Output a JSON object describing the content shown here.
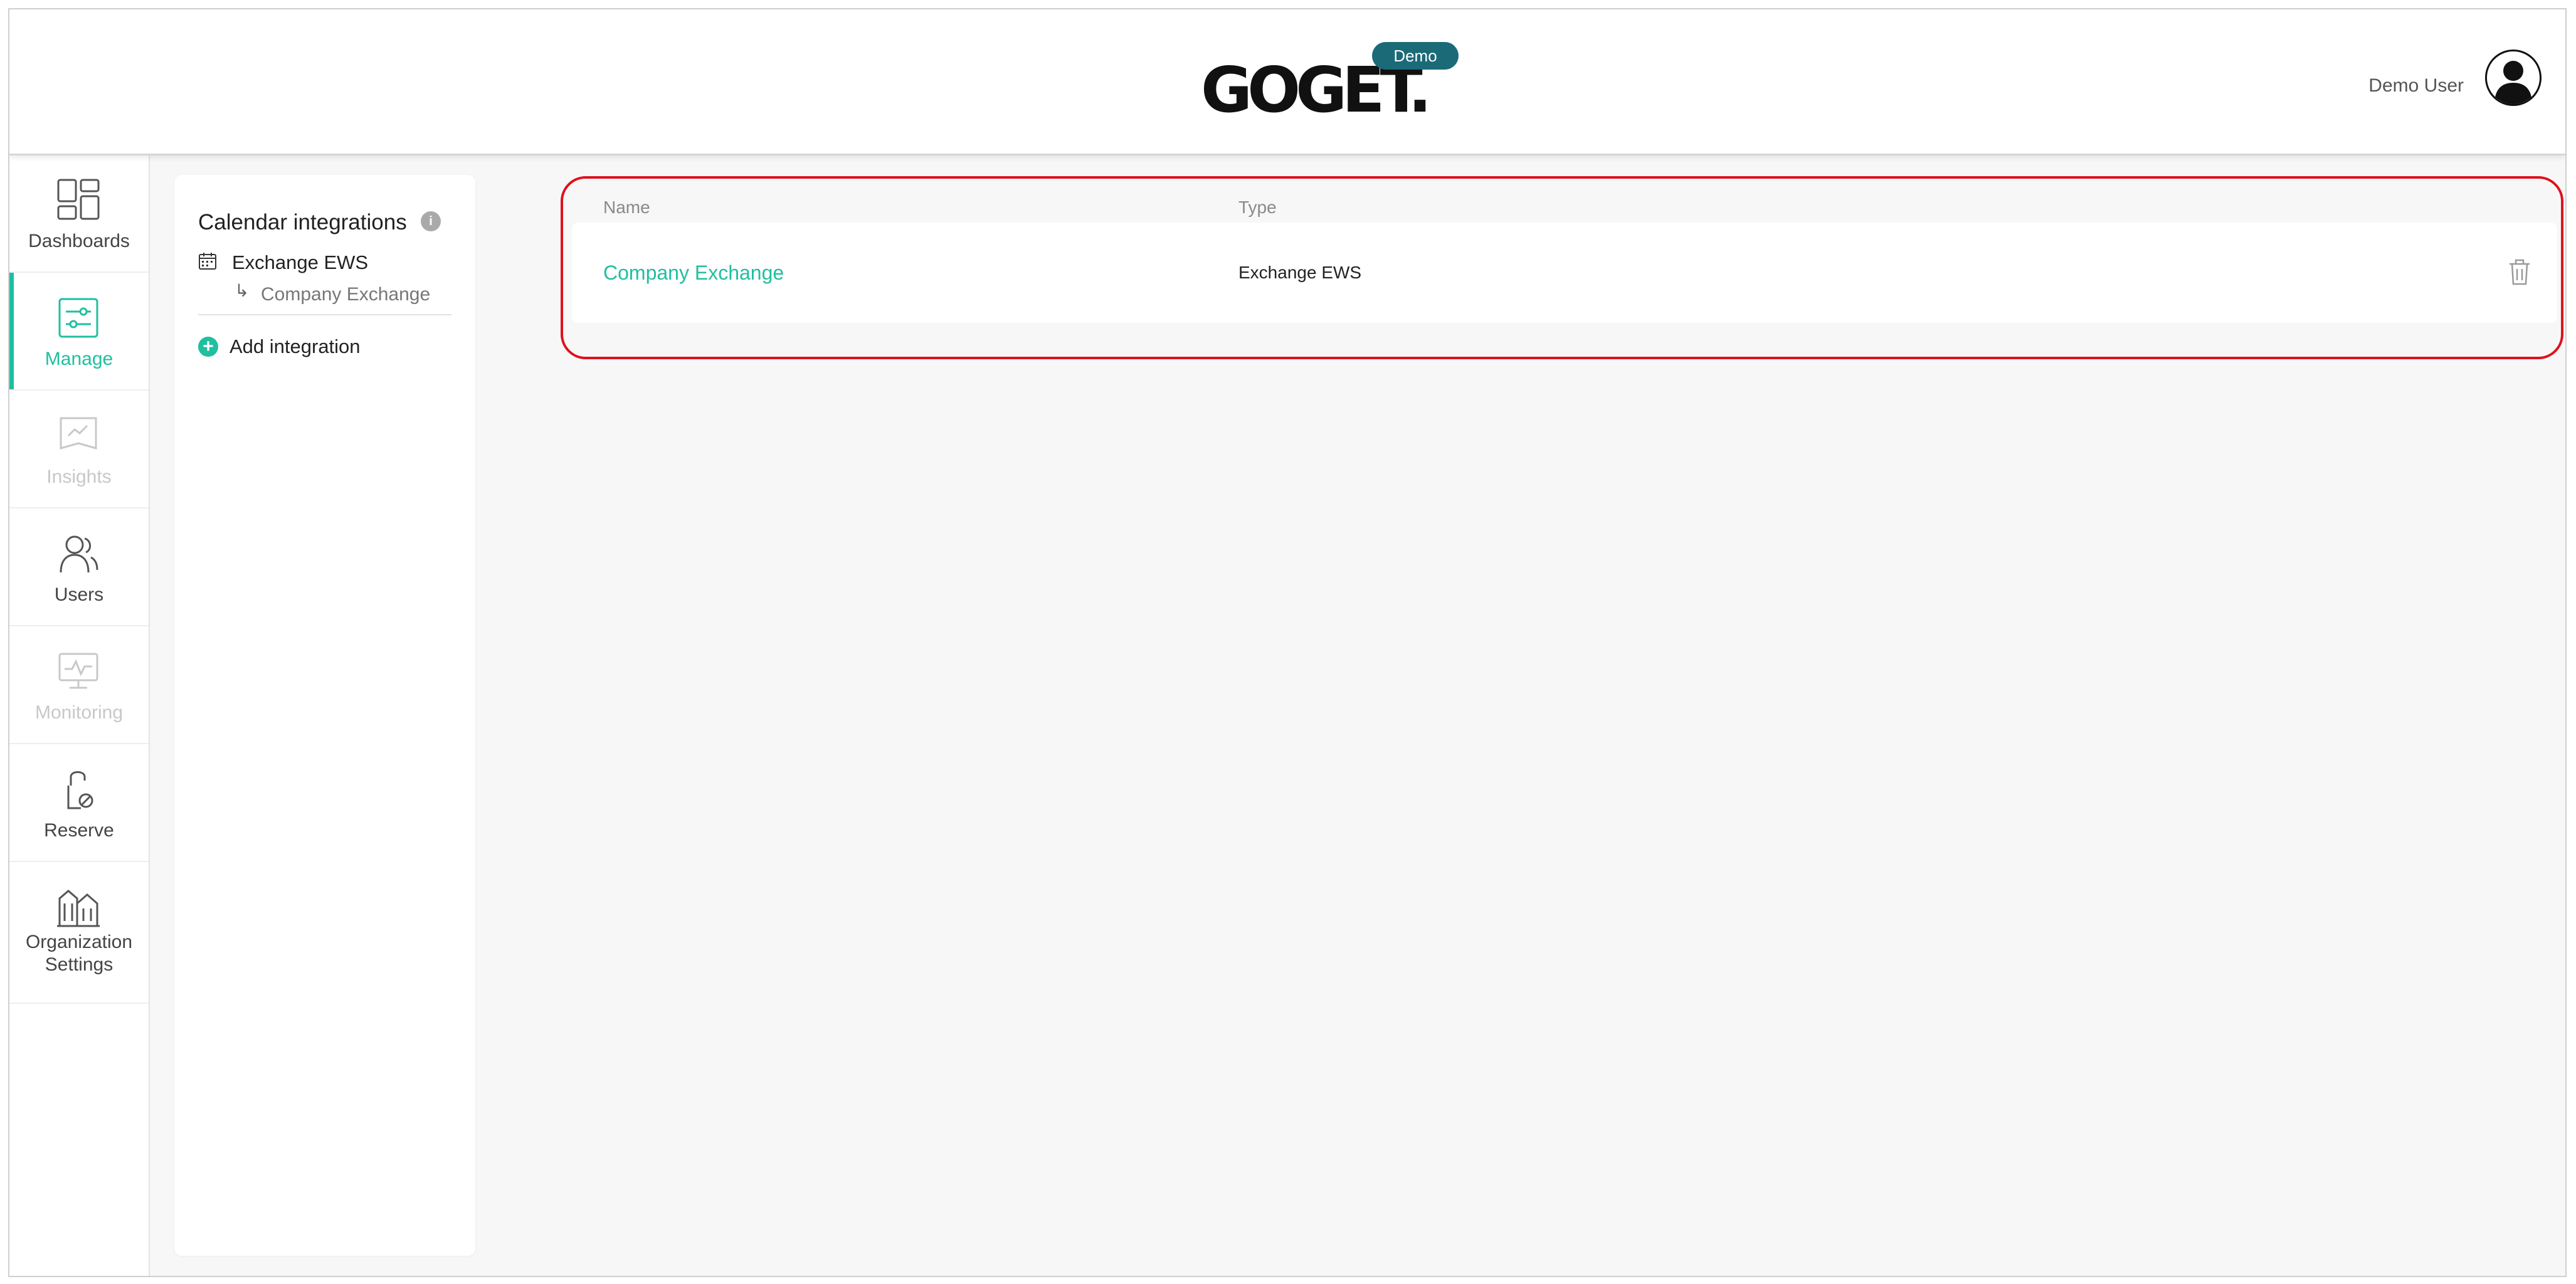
{
  "header": {
    "logo_text": "GOGET.",
    "badge": "Demo",
    "user_name": "Demo User"
  },
  "nav": {
    "items": [
      {
        "label": "Dashboards",
        "icon": "dashboards-icon",
        "state": "normal"
      },
      {
        "label": "Manage",
        "icon": "manage-icon",
        "state": "active"
      },
      {
        "label": "Insights",
        "icon": "insights-icon",
        "state": "disabled"
      },
      {
        "label": "Users",
        "icon": "users-icon",
        "state": "normal"
      },
      {
        "label": "Monitoring",
        "icon": "monitoring-icon",
        "state": "disabled"
      },
      {
        "label": "Reserve",
        "icon": "reserve-icon",
        "state": "normal"
      },
      {
        "label": "Organization Settings",
        "icon": "building-icon",
        "state": "normal"
      }
    ]
  },
  "calendar_panel": {
    "title": "Calendar integrations",
    "info": "i",
    "integration_type": "Exchange EWS",
    "integration_name": "Company Exchange",
    "add_label": "Add integration"
  },
  "table": {
    "columns": [
      "Name",
      "Type"
    ],
    "rows": [
      {
        "name": "Company Exchange",
        "type": "Exchange EWS"
      }
    ]
  },
  "colors": {
    "accent": "#1fbf9f",
    "badge": "#1b6a78",
    "highlight": "#e0101c"
  }
}
